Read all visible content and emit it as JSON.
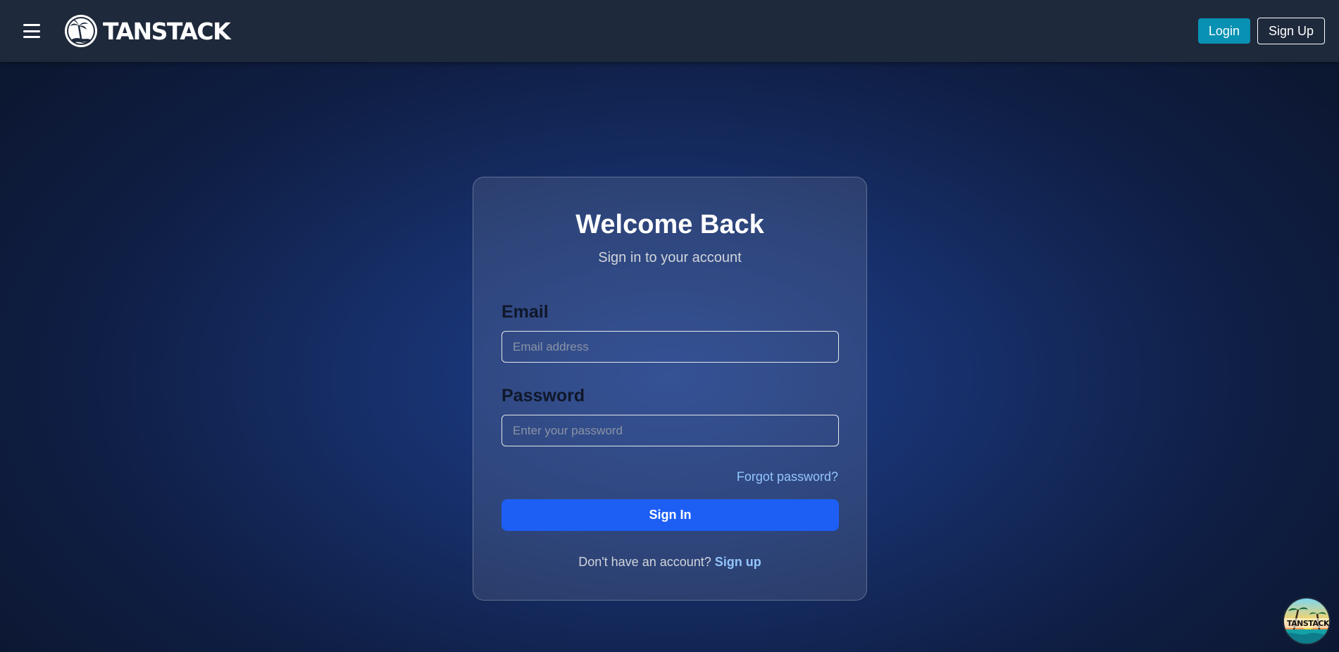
{
  "navbar": {
    "menu_icon": "hamburger-menu-icon",
    "brand_icon": "palm-tree-logo",
    "brand_text": "TANSTACK",
    "login_label": "Login",
    "signup_label": "Sign Up",
    "login_color": "#0891b2"
  },
  "login_card": {
    "title": "Welcome Back",
    "subtitle": "Sign in to your account",
    "email_label": "Email",
    "email_placeholder": "Email address",
    "email_value": "",
    "password_label": "Password",
    "password_placeholder": "Enter your password",
    "password_value": "",
    "forgot_link": "Forgot password?",
    "submit_label": "Sign In",
    "submit_color": "#1d5ff5",
    "footer_text": "Don't have an account? ",
    "footer_link": "Sign up"
  },
  "corner_badge": {
    "icon": "tanstack-devtools-logo",
    "text": "TANSTACK"
  }
}
